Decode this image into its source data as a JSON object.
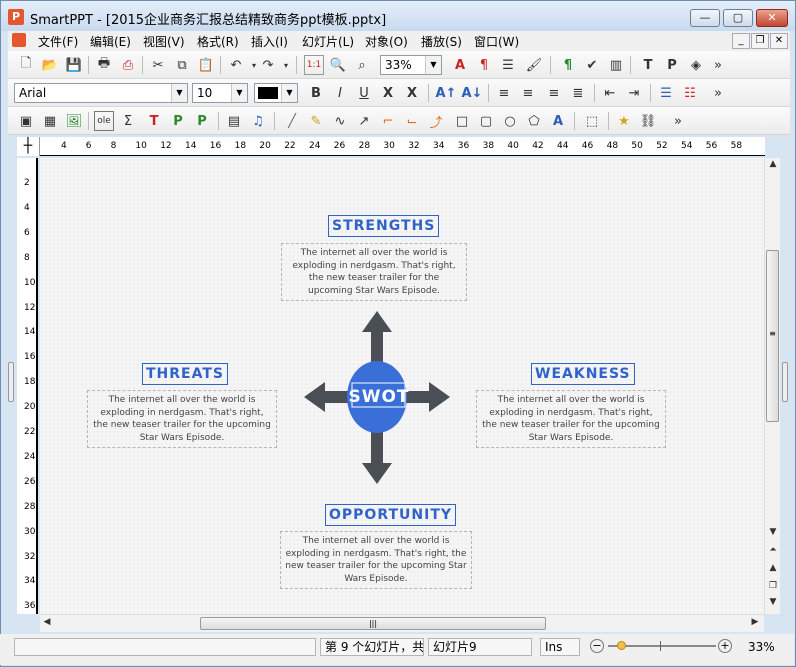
{
  "window": {
    "title": "SmartPPT - [2015企业商务汇报总结精致商务ppt模板.pptx]",
    "app_icon_letter": "P",
    "minimize": "—",
    "maximize": "▢",
    "close": "✕"
  },
  "menu": {
    "items": [
      "文件(F)",
      "编辑(E)",
      "视图(V)",
      "格式(R)",
      "插入(I)",
      "幻灯片(L)",
      "对象(O)",
      "播放(S)",
      "窗口(W)"
    ]
  },
  "toolbar": {
    "zoom_value": "33%",
    "font_name": "Arial",
    "font_size": "10",
    "more": "»"
  },
  "ruler": {
    "h_ticks": [
      "4",
      "6",
      "8",
      "10",
      "12",
      "14",
      "16",
      "18",
      "20",
      "22",
      "24",
      "26",
      "28",
      "30",
      "32",
      "34",
      "36",
      "38",
      "40",
      "42",
      "44",
      "46",
      "48",
      "50",
      "52",
      "54",
      "56",
      "58"
    ],
    "v_ticks": [
      "2",
      "4",
      "6",
      "8",
      "10",
      "12",
      "14",
      "16",
      "18",
      "20",
      "22",
      "24",
      "26",
      "28",
      "30",
      "32",
      "34",
      "36"
    ]
  },
  "slide": {
    "center_label": "SWOT",
    "strengths": {
      "title": "STRENGTHS",
      "text": "The internet all over the world is exploding in nerdgasm. That's right, the new teaser trailer for the upcoming Star Wars Episode."
    },
    "threats": {
      "title": "THREATS",
      "text": "The internet all over the world is exploding in nerdgasm. That's right, the new teaser trailer for the upcoming Star Wars Episode."
    },
    "weakness": {
      "title": "WEAKNESS",
      "text": "The internet all over the world is exploding in nerdgasm. That's right, the new teaser trailer for the upcoming Star Wars Episode."
    },
    "opportunity": {
      "title": "OPPORTUNITY",
      "text": "The internet all over the world is exploding in nerdgasm. That's right, the new teaser trailer for the upcoming Star Wars Episode."
    },
    "colors": {
      "accent": "#2f63c9",
      "arrow": "#4a4e55",
      "circle": "#3a6fd8"
    }
  },
  "statusbar": {
    "slide_info": "第 9 个幻灯片，共",
    "slide_name": "幻灯片9",
    "mode": "Ins",
    "zoom": "33%"
  }
}
